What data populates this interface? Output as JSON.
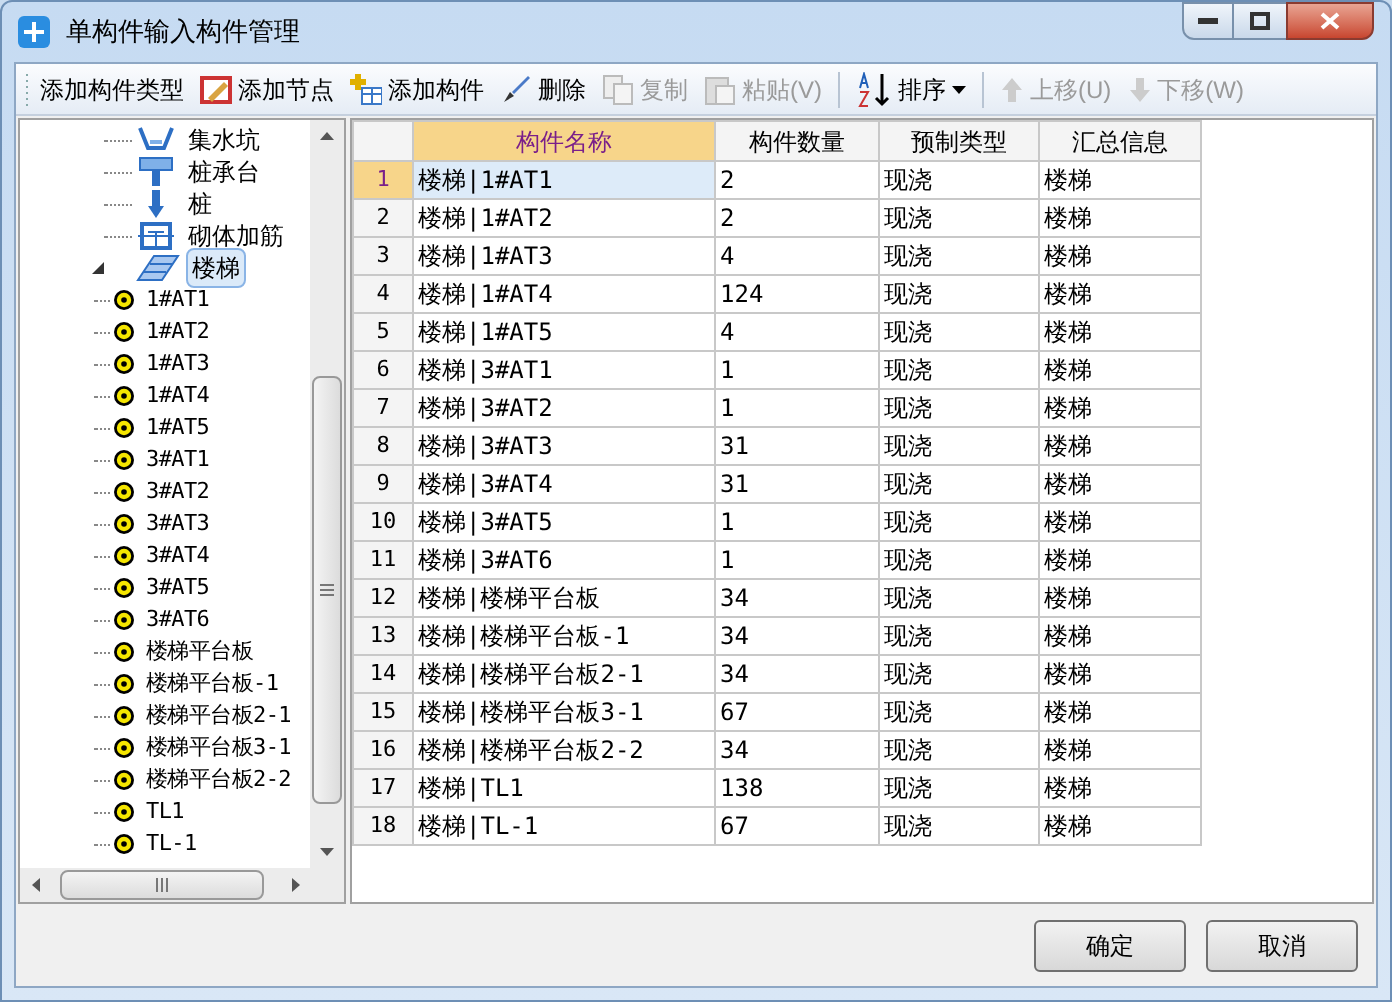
{
  "window": {
    "title": "单构件输入构件管理"
  },
  "toolbar": [
    {
      "label": "添加构件类型",
      "disabled": false,
      "separator_before": false
    },
    {
      "label": "添加节点",
      "disabled": false,
      "separator_before": false
    },
    {
      "label": "添加构件",
      "disabled": false,
      "separator_before": false
    },
    {
      "label": "删除",
      "disabled": false,
      "separator_before": false
    },
    {
      "label": "复制",
      "disabled": true,
      "separator_before": false
    },
    {
      "label": "粘贴(V)",
      "disabled": true,
      "separator_before": false
    },
    {
      "label": "排序",
      "disabled": false,
      "separator_before": true
    },
    {
      "label": "上移(U)",
      "disabled": true,
      "separator_before": true
    },
    {
      "label": "下移(W)",
      "disabled": true,
      "separator_before": false
    }
  ],
  "tree": [
    {
      "label": "集水坑",
      "selected": false
    },
    {
      "label": "桩承台",
      "selected": false
    },
    {
      "label": "桩",
      "selected": false
    },
    {
      "label": "砌体加筋",
      "selected": false
    },
    {
      "label": "楼梯",
      "selected": true,
      "expanded": true,
      "children": [
        {
          "label": "1#AT1",
          "selected": false
        },
        {
          "label": "1#AT2",
          "selected": false
        },
        {
          "label": "1#AT3",
          "selected": false
        },
        {
          "label": "1#AT4",
          "selected": false
        },
        {
          "label": "1#AT5",
          "selected": false
        },
        {
          "label": "3#AT1",
          "selected": false
        },
        {
          "label": "3#AT2",
          "selected": false
        },
        {
          "label": "3#AT3",
          "selected": false
        },
        {
          "label": "3#AT4",
          "selected": false
        },
        {
          "label": "3#AT5",
          "selected": false
        },
        {
          "label": "3#AT6",
          "selected": false
        },
        {
          "label": "楼梯平台板",
          "selected": false
        },
        {
          "label": "楼梯平台板-1",
          "selected": false
        },
        {
          "label": "楼梯平台板2-1",
          "selected": false
        },
        {
          "label": "楼梯平台板3-1",
          "selected": false
        },
        {
          "label": "楼梯平台板2-2",
          "selected": false
        },
        {
          "label": "TL1",
          "selected": false
        },
        {
          "label": "TL-1",
          "selected": false
        }
      ]
    }
  ],
  "table": {
    "columns": [
      {
        "label": "构件名称",
        "selected": true
      },
      {
        "label": "构件数量",
        "selected": false
      },
      {
        "label": "预制类型",
        "selected": false
      },
      {
        "label": "汇总信息",
        "selected": false
      }
    ],
    "rows": [
      {
        "number": "1",
        "selected": true,
        "cells": [
          "楼梯|1#AT1",
          "2",
          "现浇",
          "楼梯"
        ]
      },
      {
        "number": "2",
        "selected": false,
        "cells": [
          "楼梯|1#AT2",
          "2",
          "现浇",
          "楼梯"
        ]
      },
      {
        "number": "3",
        "selected": false,
        "cells": [
          "楼梯|1#AT3",
          "4",
          "现浇",
          "楼梯"
        ]
      },
      {
        "number": "4",
        "selected": false,
        "cells": [
          "楼梯|1#AT4",
          "124",
          "现浇",
          "楼梯"
        ]
      },
      {
        "number": "5",
        "selected": false,
        "cells": [
          "楼梯|1#AT5",
          "4",
          "现浇",
          "楼梯"
        ]
      },
      {
        "number": "6",
        "selected": false,
        "cells": [
          "楼梯|3#AT1",
          "1",
          "现浇",
          "楼梯"
        ]
      },
      {
        "number": "7",
        "selected": false,
        "cells": [
          "楼梯|3#AT2",
          "1",
          "现浇",
          "楼梯"
        ]
      },
      {
        "number": "8",
        "selected": false,
        "cells": [
          "楼梯|3#AT3",
          "31",
          "现浇",
          "楼梯"
        ]
      },
      {
        "number": "9",
        "selected": false,
        "cells": [
          "楼梯|3#AT4",
          "31",
          "现浇",
          "楼梯"
        ]
      },
      {
        "number": "10",
        "selected": false,
        "cells": [
          "楼梯|3#AT5",
          "1",
          "现浇",
          "楼梯"
        ]
      },
      {
        "number": "11",
        "selected": false,
        "cells": [
          "楼梯|3#AT6",
          "1",
          "现浇",
          "楼梯"
        ]
      },
      {
        "number": "12",
        "selected": false,
        "cells": [
          "楼梯|楼梯平台板",
          "34",
          "现浇",
          "楼梯"
        ]
      },
      {
        "number": "13",
        "selected": false,
        "cells": [
          "楼梯|楼梯平台板-1",
          "34",
          "现浇",
          "楼梯"
        ]
      },
      {
        "number": "14",
        "selected": false,
        "cells": [
          "楼梯|楼梯平台板2-1",
          "34",
          "现浇",
          "楼梯"
        ]
      },
      {
        "number": "15",
        "selected": false,
        "cells": [
          "楼梯|楼梯平台板3-1",
          "67",
          "现浇",
          "楼梯"
        ]
      },
      {
        "number": "16",
        "selected": false,
        "cells": [
          "楼梯|楼梯平台板2-2",
          "34",
          "现浇",
          "楼梯"
        ]
      },
      {
        "number": "17",
        "selected": false,
        "cells": [
          "楼梯|TL1",
          "138",
          "现浇",
          "楼梯"
        ]
      },
      {
        "number": "18",
        "selected": false,
        "cells": [
          "楼梯|TL-1",
          "67",
          "现浇",
          "楼梯"
        ]
      }
    ]
  },
  "buttons": [
    "确定",
    "取消"
  ]
}
